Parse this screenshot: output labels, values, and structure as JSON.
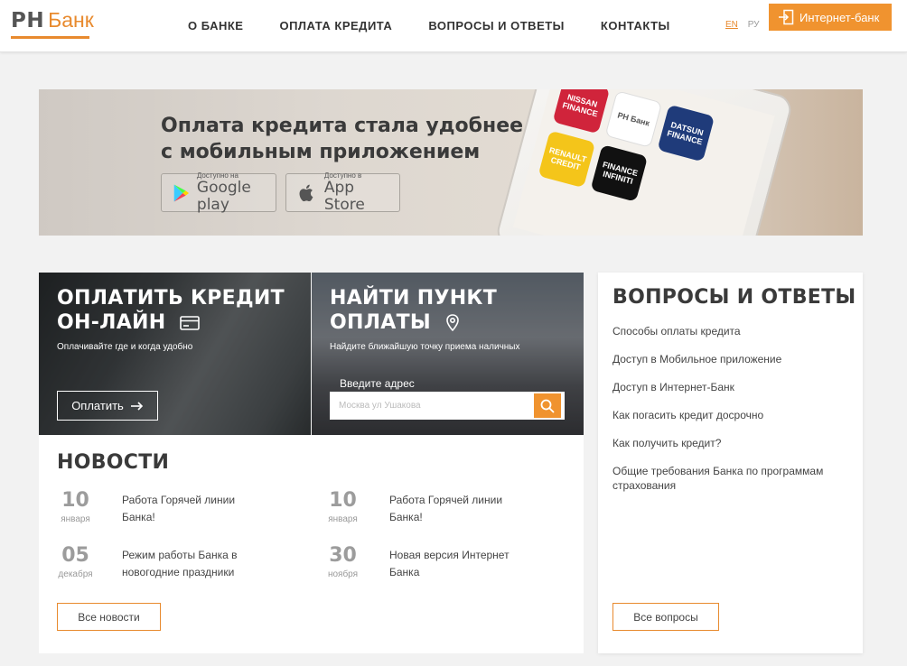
{
  "header": {
    "logo_rh": "РН",
    "logo_bank": "Банк",
    "nav": [
      "О БАНКЕ",
      "ОПЛАТА КРЕДИТА",
      "ВОПРОСЫ И ОТВЕТЫ",
      "КОНТАКТЫ"
    ],
    "lang_en": "EN",
    "lang_ru": "РУ",
    "internet_bank_label": "Интернет-банк",
    "accent_color": "#f0932f"
  },
  "banner": {
    "title_line1": "Оплата кредита стала удобнее",
    "title_line2": "с мобильным приложением",
    "google_play_small": "Доступно на",
    "google_play_big": "Google play",
    "app_store_small": "Доступно в",
    "app_store_big": "App Store",
    "apps": [
      {
        "label": "NISSAN FINANCE",
        "icon": "nissan-finance-app"
      },
      {
        "label": "РН Банк",
        "icon": "rn-bank-app"
      },
      {
        "label": "DATSUN FINANCE",
        "icon": "datsun-finance-app"
      },
      {
        "label": "RENAULT CREDIT",
        "icon": "renault-credit-app"
      },
      {
        "label": "FINANCE INFINITI",
        "icon": "infiniti-finance-app"
      }
    ]
  },
  "pay_card": {
    "title_line1": "ОПЛАТИТЬ КРЕДИТ",
    "title_line2": "ОН-ЛАЙН",
    "subtitle": "Оплачивайте где и когда удобно",
    "button_label": "Оплатить"
  },
  "find_card": {
    "title_line1": "НАЙТИ ПУНКТ",
    "title_line2": "ОПЛАТЫ",
    "subtitle": "Найдите ближайшую точку приема наличных",
    "address_label": "Введите адрес",
    "address_placeholder": "Москва ул Ушакова"
  },
  "news": {
    "title": "НОВОСТИ",
    "items": [
      {
        "day": "10",
        "month": "января",
        "text": "Работа Горячей линии Банка!"
      },
      {
        "day": "10",
        "month": "января",
        "text": "Работа Горячей линии Банка!"
      },
      {
        "day": "05",
        "month": "декабря",
        "text": "Режим работы Банка в новогодние праздники"
      },
      {
        "day": "30",
        "month": "ноября",
        "text": "Новая версия Интернет Банка"
      }
    ],
    "all_button": "Все новости"
  },
  "faq": {
    "title": "ВОПРОСЫ И ОТВЕТЫ",
    "items": [
      "Способы оплаты кредита",
      "Доступ в Мобильное приложение",
      "Доступ в Интернет-Банк",
      "Как погасить кредит досрочно",
      "Как получить кредит?",
      "Общие требования Банка по программам страхования"
    ],
    "all_button": "Все вопросы"
  }
}
